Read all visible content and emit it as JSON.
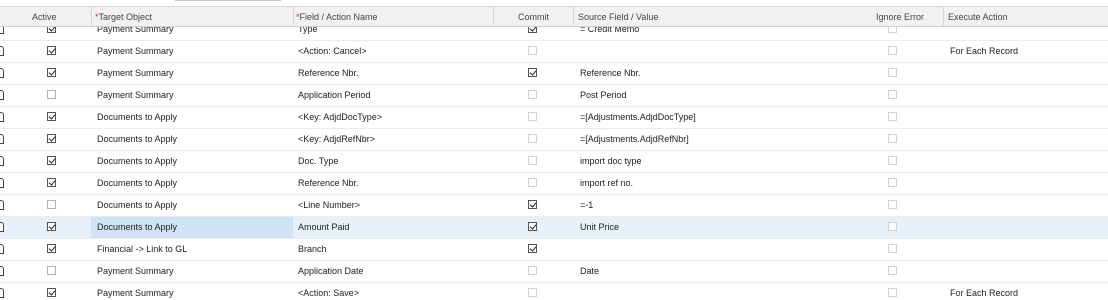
{
  "columns": {
    "active": "Active",
    "target_object": "Target Object",
    "field_action": "Field / Action Name",
    "commit": "Commit",
    "source_value": "Source Field / Value",
    "ignore_error": "Ignore Error",
    "execute_action": "Execute Action",
    "required_mark": "*"
  },
  "rows": [
    {
      "active": true,
      "target": "Payment Summary",
      "field": "Type",
      "commit": true,
      "source": "= Credit Memo",
      "ignore": false,
      "execute": ""
    },
    {
      "active": true,
      "target": "Payment Summary",
      "field": "<Action: Cancel>",
      "commit": false,
      "source": "",
      "ignore": false,
      "execute": "For Each Record"
    },
    {
      "active": true,
      "target": "Payment Summary",
      "field": "Reference Nbr.",
      "commit": true,
      "source": "Reference Nbr.",
      "ignore": false,
      "execute": ""
    },
    {
      "active": false,
      "target": "Payment Summary",
      "field": "Application Period",
      "commit": false,
      "source": "Post Period",
      "ignore": false,
      "execute": ""
    },
    {
      "active": true,
      "target": "Documents to Apply",
      "field": "<Key: AdjdDocType>",
      "commit": false,
      "source": "=[Adjustments.AdjdDocType]",
      "ignore": false,
      "execute": ""
    },
    {
      "active": true,
      "target": "Documents to Apply",
      "field": "<Key: AdjdRefNbr>",
      "commit": false,
      "source": "=[Adjustments.AdjdRefNbr]",
      "ignore": false,
      "execute": ""
    },
    {
      "active": true,
      "target": "Documents to Apply",
      "field": "Doc. Type",
      "commit": false,
      "source": "import doc type",
      "ignore": false,
      "execute": ""
    },
    {
      "active": true,
      "target": "Documents to Apply",
      "field": "Reference Nbr.",
      "commit": false,
      "source": "import ref no.",
      "ignore": false,
      "execute": ""
    },
    {
      "active": false,
      "target": "Documents to Apply",
      "field": "<Line Number>",
      "commit": true,
      "source": "=-1",
      "ignore": false,
      "execute": ""
    },
    {
      "active": true,
      "target": "Documents to Apply",
      "field": "Amount Paid",
      "commit": true,
      "source": "Unit Price",
      "ignore": false,
      "execute": "",
      "selected": true
    },
    {
      "active": true,
      "target": "Financial -> Link to GL",
      "field": "Branch",
      "commit": true,
      "source": "",
      "ignore": false,
      "execute": ""
    },
    {
      "active": false,
      "target": "Payment Summary",
      "field": "Application Date",
      "commit": false,
      "source": "Date",
      "ignore": false,
      "execute": ""
    },
    {
      "active": true,
      "target": "Payment Summary",
      "field": "<Action: Save>",
      "commit": false,
      "source": "",
      "ignore": false,
      "execute": "For Each Record"
    }
  ]
}
